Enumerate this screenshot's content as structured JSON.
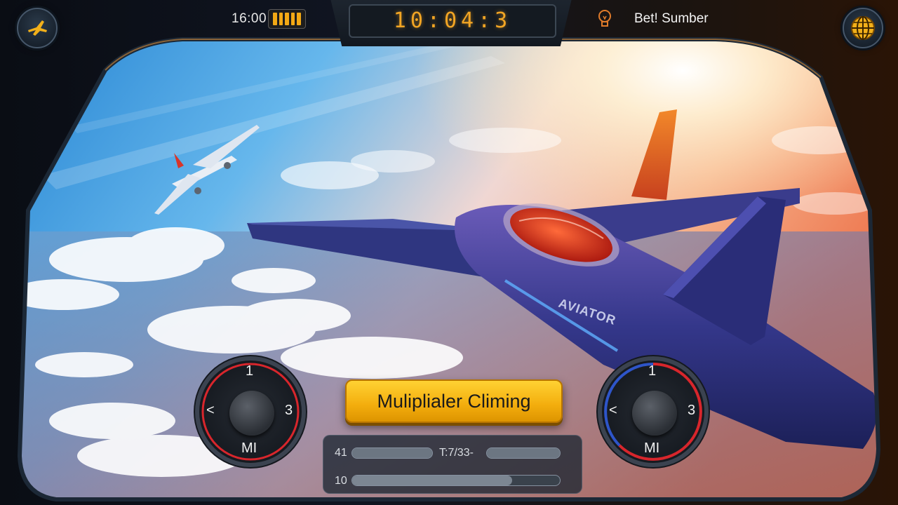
{
  "hud": {
    "clock": "16:00",
    "battery_level": 1.0,
    "timer": "10:04:3",
    "bet_label": "Bet! Sumber",
    "icons": {
      "left": "plane-logo-icon",
      "right": "globe-icon",
      "bulb": "lightbulb-icon",
      "battery": "battery-icon"
    }
  },
  "airplane": {
    "fuselage_text": "AVIATOR"
  },
  "gauges": {
    "left": {
      "top": "1",
      "left": "<",
      "right": "3",
      "bottom": "MI"
    },
    "right": {
      "top": "1",
      "left": "<",
      "right": "3",
      "bottom": "MI"
    }
  },
  "multiplier_button": {
    "label": "Muliplialer Climing"
  },
  "stats_panel": {
    "row1_label": "41",
    "row1_center": "T:7/33-",
    "row2_label": "10",
    "row2_fill": 0.77
  },
  "colors": {
    "accent_orange": "#f2a524",
    "button_yellow": "#ffd233",
    "gauge_red": "#d8262c",
    "gauge_blue": "#2e55c9"
  }
}
